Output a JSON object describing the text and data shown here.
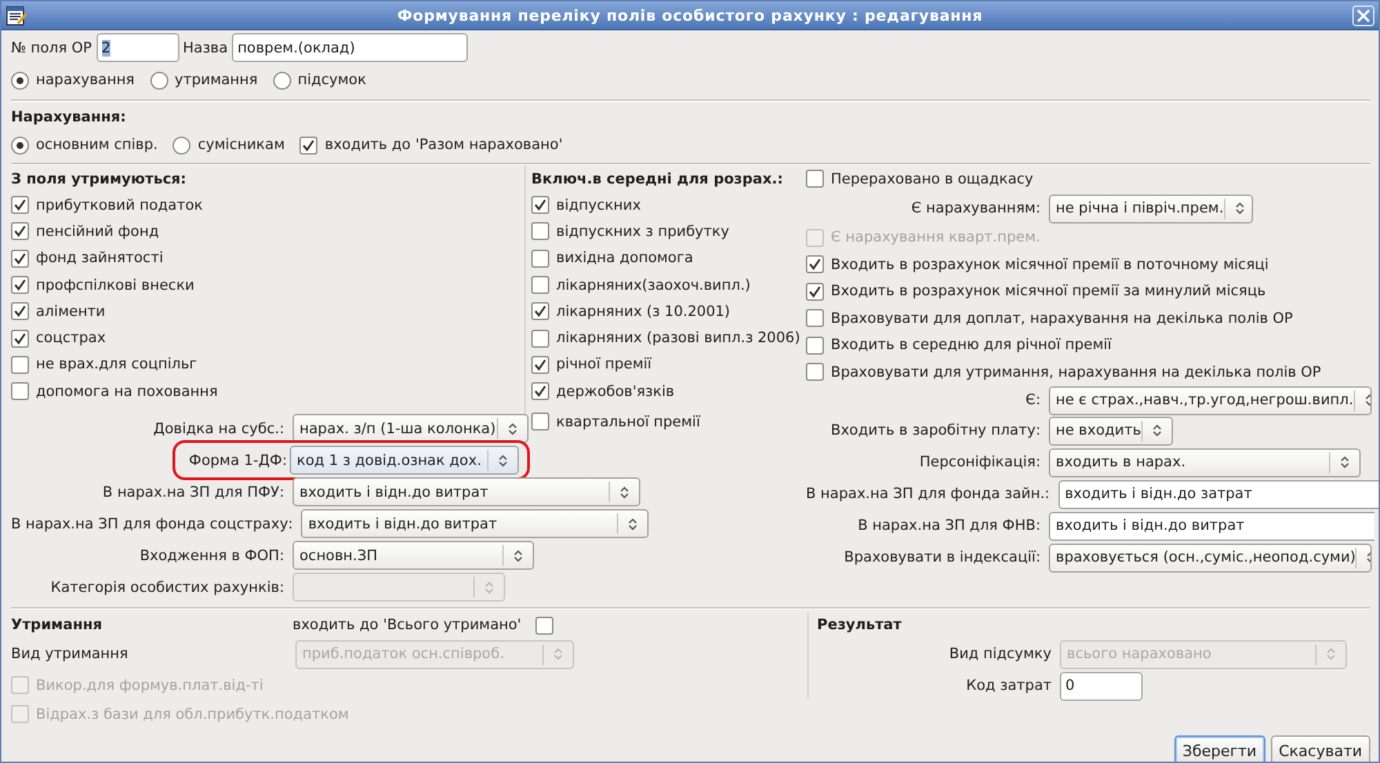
{
  "window": {
    "title": "Формування переліку полів особистого рахунку : редагування"
  },
  "header": {
    "number_label": "№ поля ОР",
    "number_value": "2",
    "number_value_selected": true,
    "name_label": "Назва",
    "name_value": "поврем.(оклад)"
  },
  "field_type": [
    {
      "label": "нарахування",
      "selected": true
    },
    {
      "label": "утримання",
      "selected": false
    },
    {
      "label": "підсумок",
      "selected": false
    }
  ],
  "accrual": {
    "title": "Нарахування:",
    "employee_type": [
      {
        "label": "основним співр.",
        "selected": true
      },
      {
        "label": "сумісникам",
        "selected": false
      }
    ],
    "include_total": {
      "label": "входить до 'Разом нараховано'",
      "checked": true
    }
  },
  "withheld_from": {
    "title": "З поля утримуються:",
    "items": [
      {
        "label": "прибутковий податок",
        "checked": true
      },
      {
        "label": "пенсійний фонд",
        "checked": true
      },
      {
        "label": "фонд зайнятості",
        "checked": true
      },
      {
        "label": "профспілкові внески",
        "checked": true
      },
      {
        "label": "аліменти",
        "checked": true
      },
      {
        "label": "соцстрах",
        "checked": true
      },
      {
        "label": "не врах.для соцпільг",
        "checked": false
      },
      {
        "label": "допомога на поховання",
        "checked": false
      }
    ]
  },
  "average": {
    "title": "Включ.в середні для розрах.:",
    "items": [
      {
        "label": "відпускних",
        "checked": true
      },
      {
        "label": "відпускних з прибутку",
        "checked": false
      },
      {
        "label": "вихідна допомога",
        "checked": false
      },
      {
        "label": "лікарняних(заохоч.випл.)",
        "checked": false
      },
      {
        "label": "лікарняних (з 10.2001)",
        "checked": true
      },
      {
        "label": "лікарняних (разові випл.з 2006)",
        "checked": false
      },
      {
        "label": "річної премії",
        "checked": true
      },
      {
        "label": "держобов'язків",
        "checked": true
      },
      {
        "label": "квартальної премії",
        "checked": false
      }
    ]
  },
  "left_combos": [
    {
      "label": "Довідка на субс.:",
      "value": "нарах. з/п (1-ша колонка)",
      "disabled": false,
      "highlighted": false
    },
    {
      "label": "Форма 1-ДФ:",
      "value": "код 1 з довід.ознак дох.",
      "disabled": false,
      "highlighted": true
    },
    {
      "label": "В нарах.на ЗП для ПФУ:",
      "value": "входить і відн.до витрат",
      "disabled": false,
      "highlighted": false
    },
    {
      "label": "В нарах.на ЗП для фонда соцстраху:",
      "value": "входить і відн.до витрат",
      "disabled": false,
      "highlighted": false
    },
    {
      "label": "Входження в ФОП:",
      "value": "основн.ЗП",
      "disabled": false,
      "highlighted": false
    },
    {
      "label": "Категорія особистих рахунків:",
      "disabled": true,
      "highlighted": false
    }
  ],
  "options": [
    {
      "kind": "checkbox",
      "label": "Перераховано в ощадкасу",
      "checked": false,
      "disabled": false
    },
    {
      "kind": "combo",
      "label": "Є нарахуванням:",
      "value": "не річна і півріч.прем."
    },
    {
      "kind": "checkbox",
      "label": "Є нарахування кварт.прем.",
      "checked": false,
      "disabled": true
    },
    {
      "kind": "checkbox",
      "label": "Входить в розрахунок місячної премії в поточному місяці",
      "checked": true,
      "disabled": false
    },
    {
      "kind": "checkbox",
      "label": "Входить в розрахунок місячної премії за минулий місяць",
      "checked": true,
      "disabled": false
    },
    {
      "kind": "checkbox",
      "label": "Враховувати для доплат, нарахування на декілька полів ОР",
      "checked": false,
      "disabled": false
    },
    {
      "kind": "checkbox",
      "label": "Входить в середню для річної премії",
      "checked": false,
      "disabled": false
    },
    {
      "kind": "checkbox",
      "label": "Враховувати для утримання, нарахування на декілька полів ОР",
      "checked": false,
      "disabled": false
    },
    {
      "kind": "combo",
      "label": "Є:",
      "value": "не є страх.,навч.,тр.угод,негрош.випл."
    },
    {
      "kind": "combo",
      "label": "Входить в заробітну плату:",
      "value": "не входить"
    },
    {
      "kind": "combo",
      "label": "Персоніфікація:",
      "value": "входить в нарах."
    },
    {
      "kind": "cut",
      "label": "В нарах.на ЗП для фонда зайн.:",
      "value": "входить і відн.до затрат"
    },
    {
      "kind": "cut",
      "label": "В нарах.на ЗП для ФНВ:",
      "value": "входить і відн.до витрат"
    },
    {
      "kind": "combo",
      "label": "Враховувати в індексації:",
      "value": "враховується (осн.,суміс.,неопод.суми)"
    }
  ],
  "deduction": {
    "title": "Утримання",
    "include_label": "входить до 'Всього утримано'",
    "include_checked": false,
    "type_label": "Вид утримання",
    "type_value": "приб.податок осн.співроб.",
    "type_disabled": true,
    "checks": [
      {
        "label": "Викор.для формув.плат.від-ті",
        "checked": false,
        "disabled": true
      },
      {
        "label": "Відрах.з бази для обл.прибутк.податком",
        "checked": false,
        "disabled": true
      }
    ]
  },
  "result": {
    "title": "Результат",
    "total_label": "Вид підсумку",
    "total_value": "всього нараховано",
    "total_disabled": true,
    "cost_label": "Код затрат",
    "cost_value": "0"
  },
  "buttons": [
    {
      "label": "Зберегти",
      "default": true
    },
    {
      "label": "Скасувати",
      "default": false
    }
  ]
}
